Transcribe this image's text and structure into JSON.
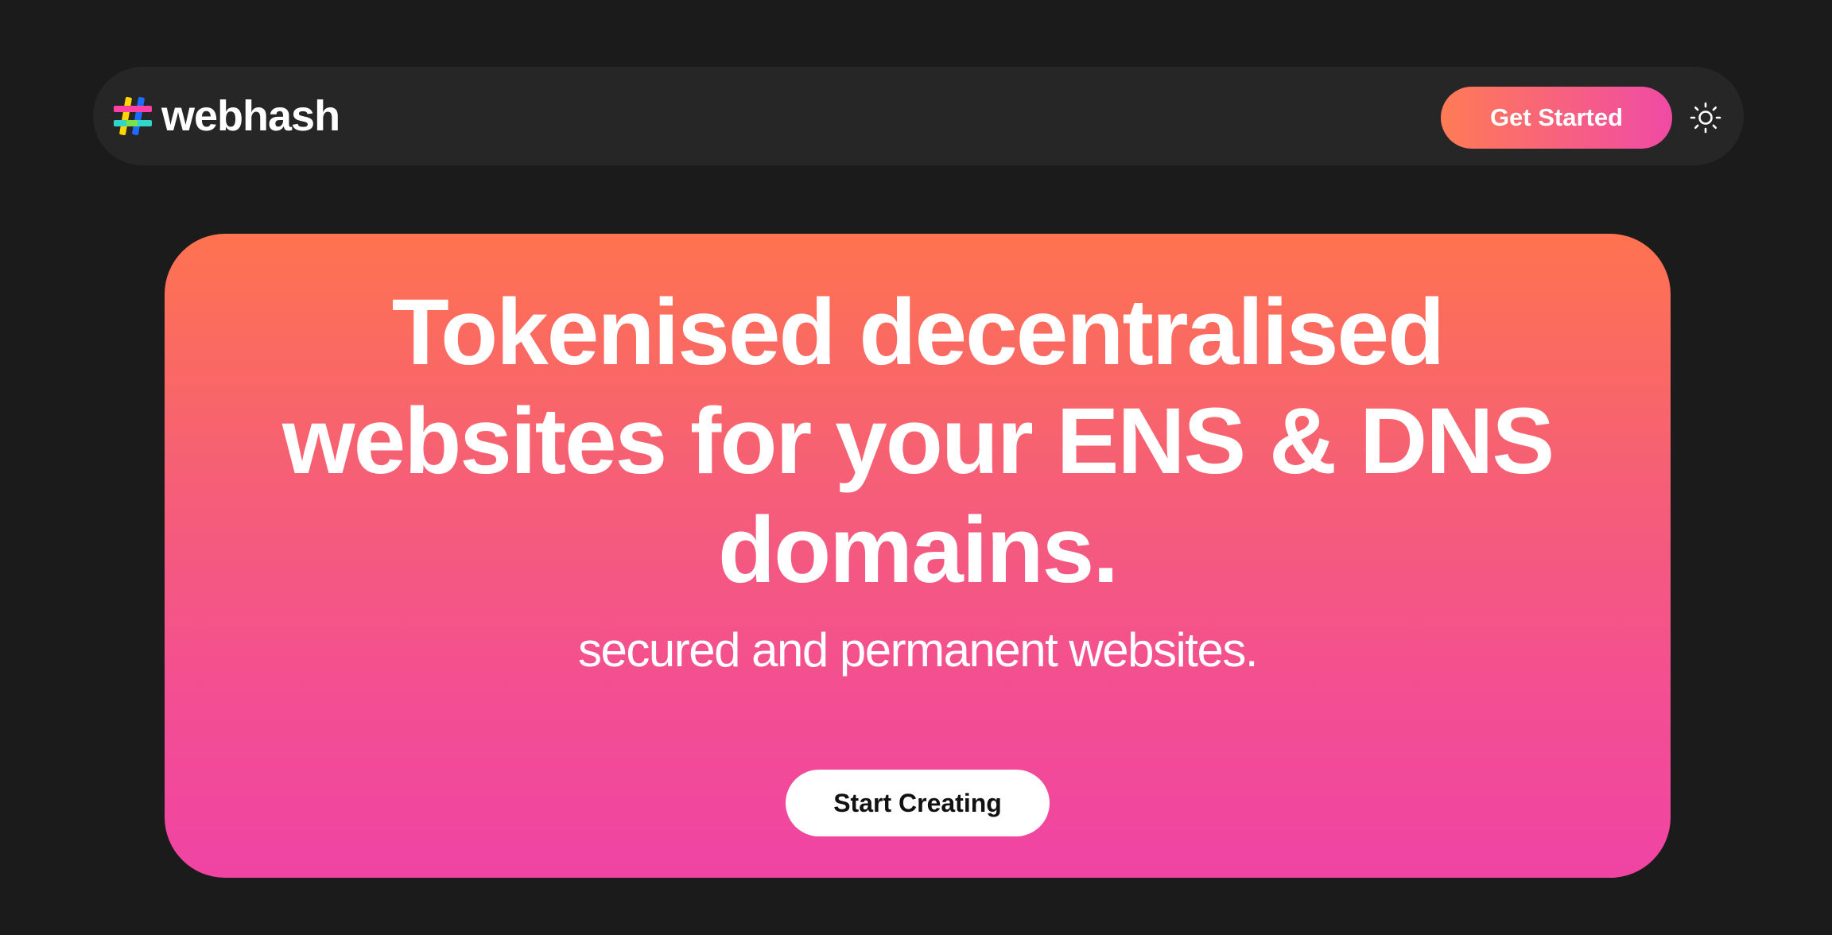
{
  "navbar": {
    "logo": {
      "icon": "hash-logo-icon",
      "text": "webhash"
    },
    "get_started_label": "Get Started",
    "theme_toggle_icon": "sun-icon"
  },
  "hero": {
    "title_lines": [
      "Tokenised decentralised",
      "websites for your ENS & DNS",
      "domains."
    ],
    "subtitle": "secured and permanent websites.",
    "cta_label": "Start Creating"
  },
  "colors": {
    "background": "#1b1b1b",
    "navbar_background": "#262626",
    "gradient_top": "#ff7350",
    "gradient_bottom": "#f044a4",
    "cta_background": "#ffffff"
  }
}
